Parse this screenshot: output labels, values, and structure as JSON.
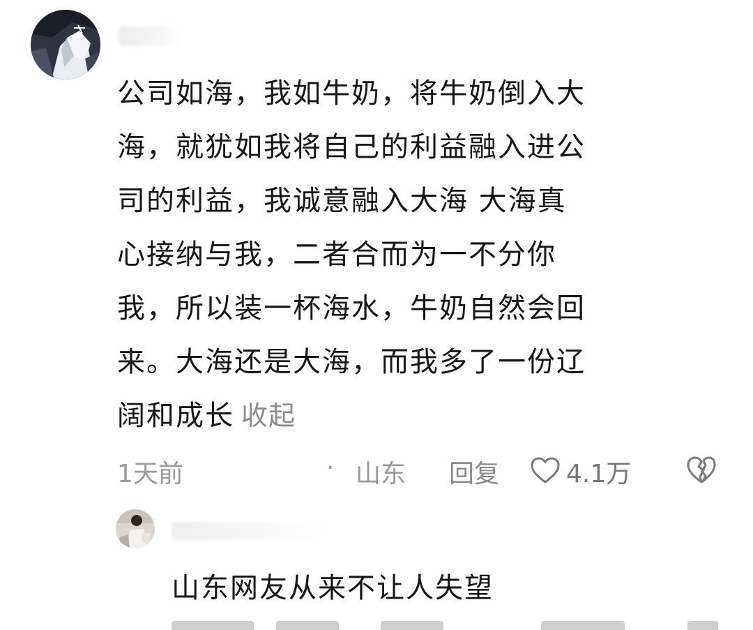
{
  "comment": {
    "lines": [
      "公司如海，我如牛奶，将牛奶倒入大",
      "海，就犹如我将自己的利益融入进公",
      "司的利益，我诚意融入大海   大海真",
      "心接纳与我，二者合而为一不分你",
      "我，所以装一杯海水，牛奶自然会回",
      "来。大海还是大海，而我多了一份辽",
      "阔和成长"
    ],
    "collapse_label": "收起",
    "time": "1天前",
    "separator": "·",
    "location": "山东",
    "reply_label": "回复",
    "like_count": "4.1万",
    "like_icon": "heart-outline-icon",
    "dislike_icon": "broken-heart-icon"
  },
  "reply": {
    "text": "山东网友从来不让人失望"
  },
  "colors": {
    "text": "#161616",
    "meta": "#9a9a9a",
    "background": "#ffffff"
  }
}
